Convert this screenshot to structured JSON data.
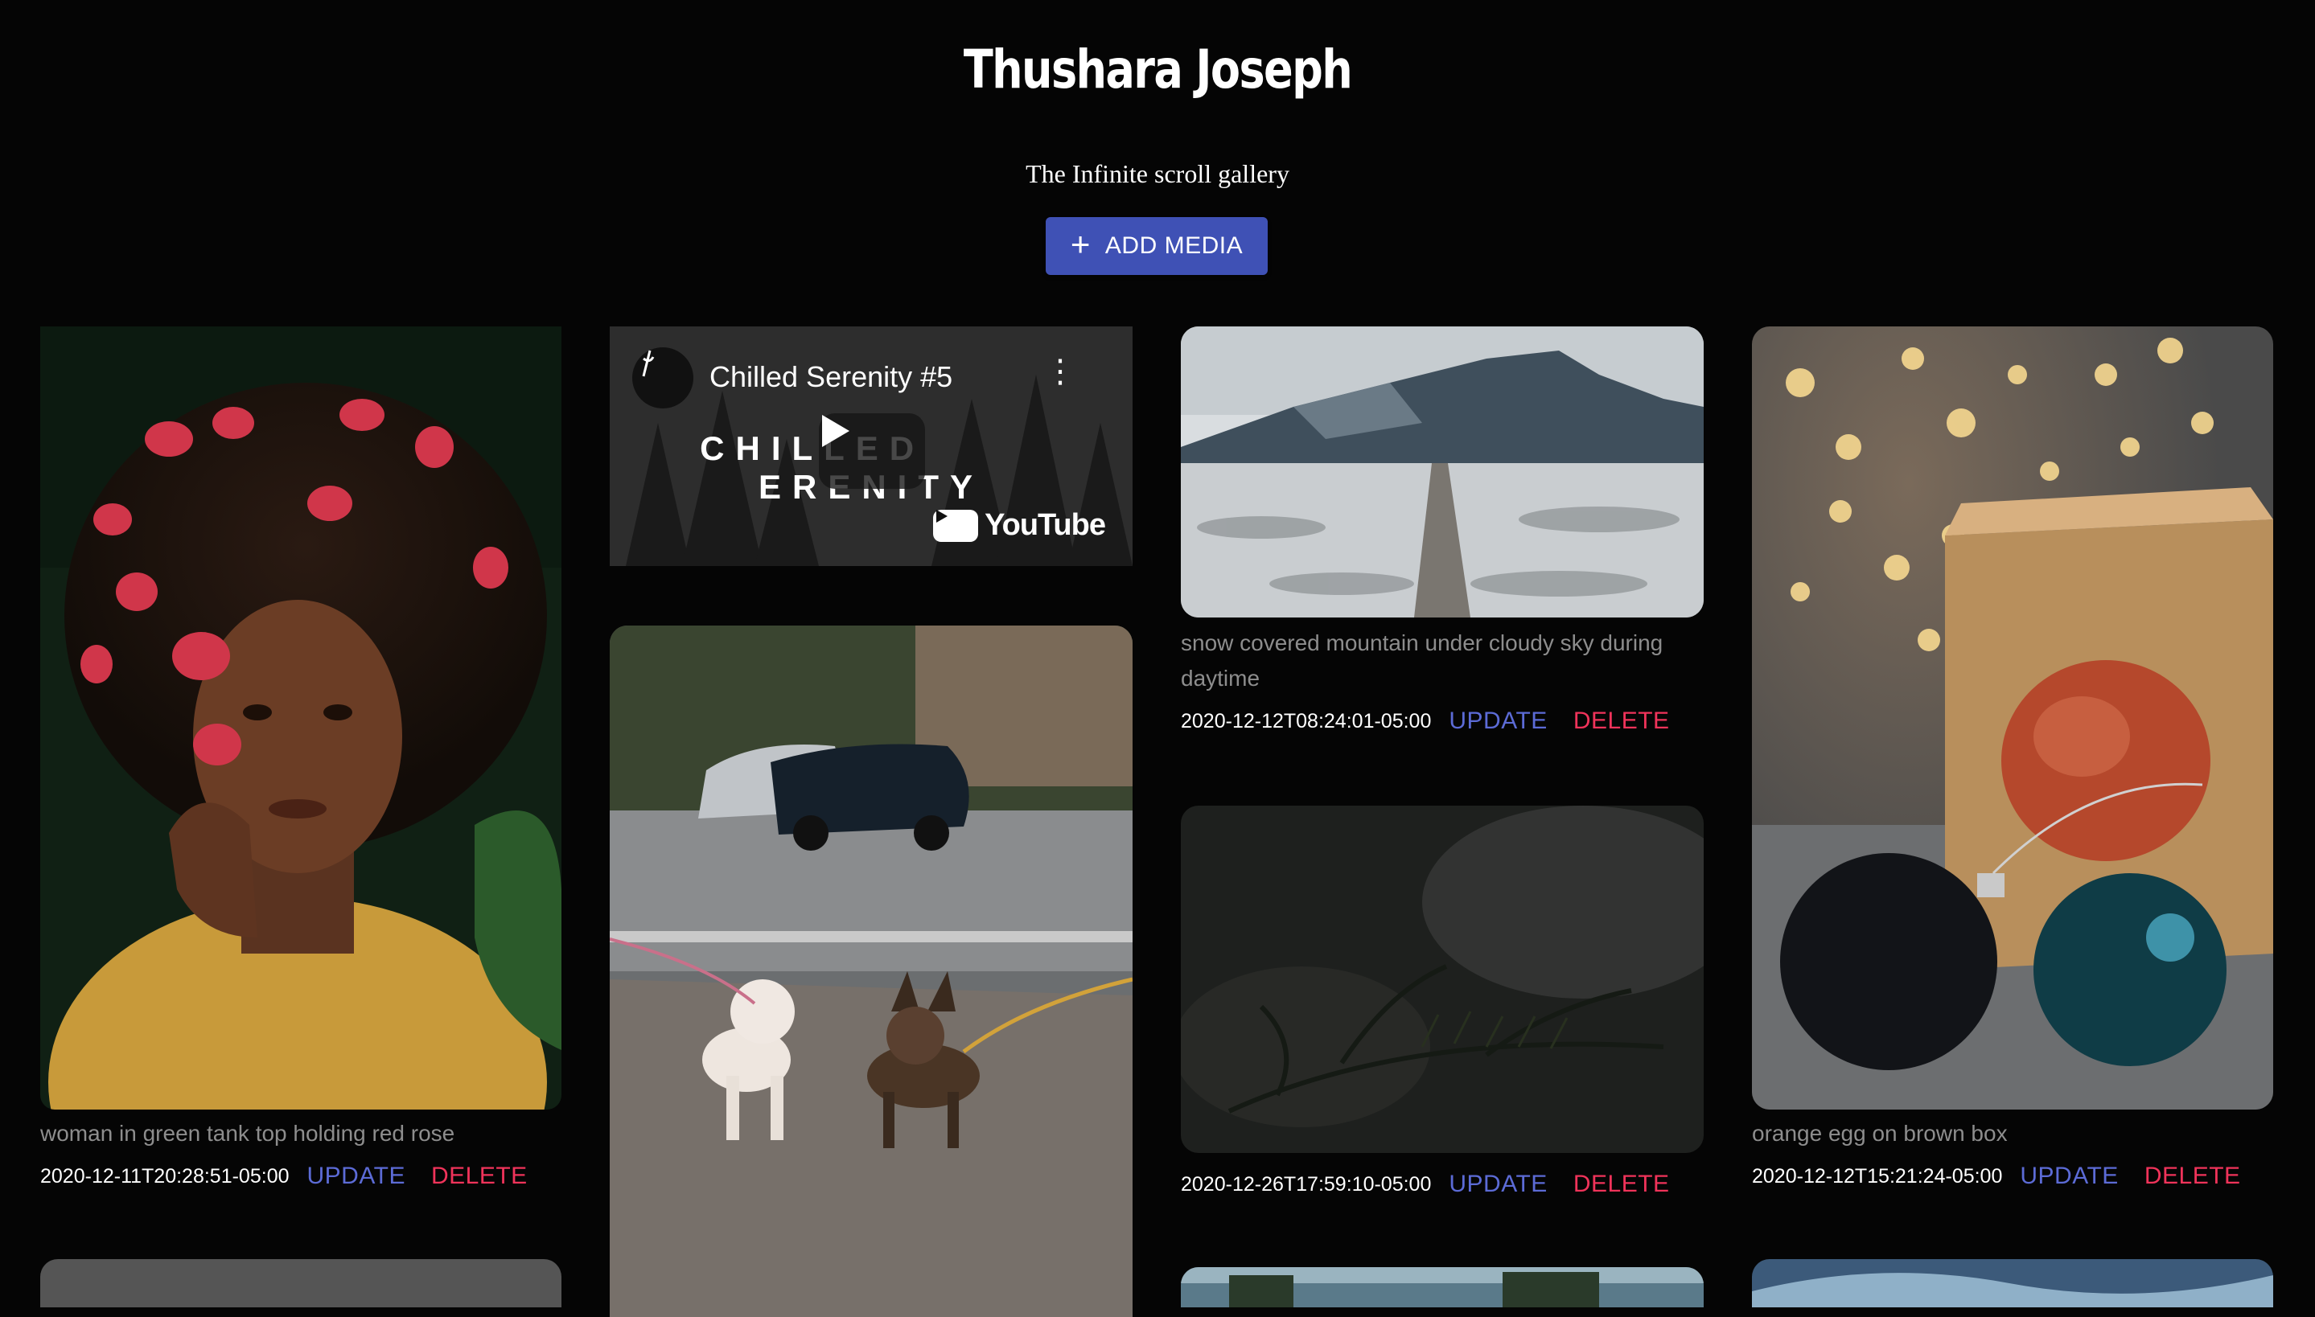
{
  "header": {
    "title": "Thushara Joseph",
    "subtitle": "The Infinite scroll gallery",
    "add_media_label": "ADD MEDIA",
    "add_icon": "+"
  },
  "gallery": {
    "cards": [
      {
        "alt": "woman in green tank top holding red rose",
        "date": "2020-12-11T20:28:51-05:00",
        "update_label": "UPDATE",
        "delete_label": "DELETE"
      },
      {
        "alt": "snow covered mountain under cloudy sky during daytime",
        "date": "2020-12-12T08:24:01-05:00",
        "update_label": "UPDATE",
        "delete_label": "DELETE"
      },
      {
        "alt": "",
        "date": "2020-12-26T17:59:10-05:00",
        "update_label": "UPDATE",
        "delete_label": "DELETE"
      },
      {
        "alt": "orange egg on brown box",
        "date": "2020-12-12T15:21:24-05:00",
        "update_label": "UPDATE",
        "delete_label": "DELETE"
      }
    ],
    "video": {
      "title": "Chilled Serenity #5",
      "overlay_left": "CHILLED",
      "overlay_right": "ERENITY",
      "brand": "YouTube"
    }
  },
  "colors": {
    "accent": "#3f51b5",
    "update": "#5c6bd6",
    "delete": "#f0335a",
    "background": "#050505"
  }
}
